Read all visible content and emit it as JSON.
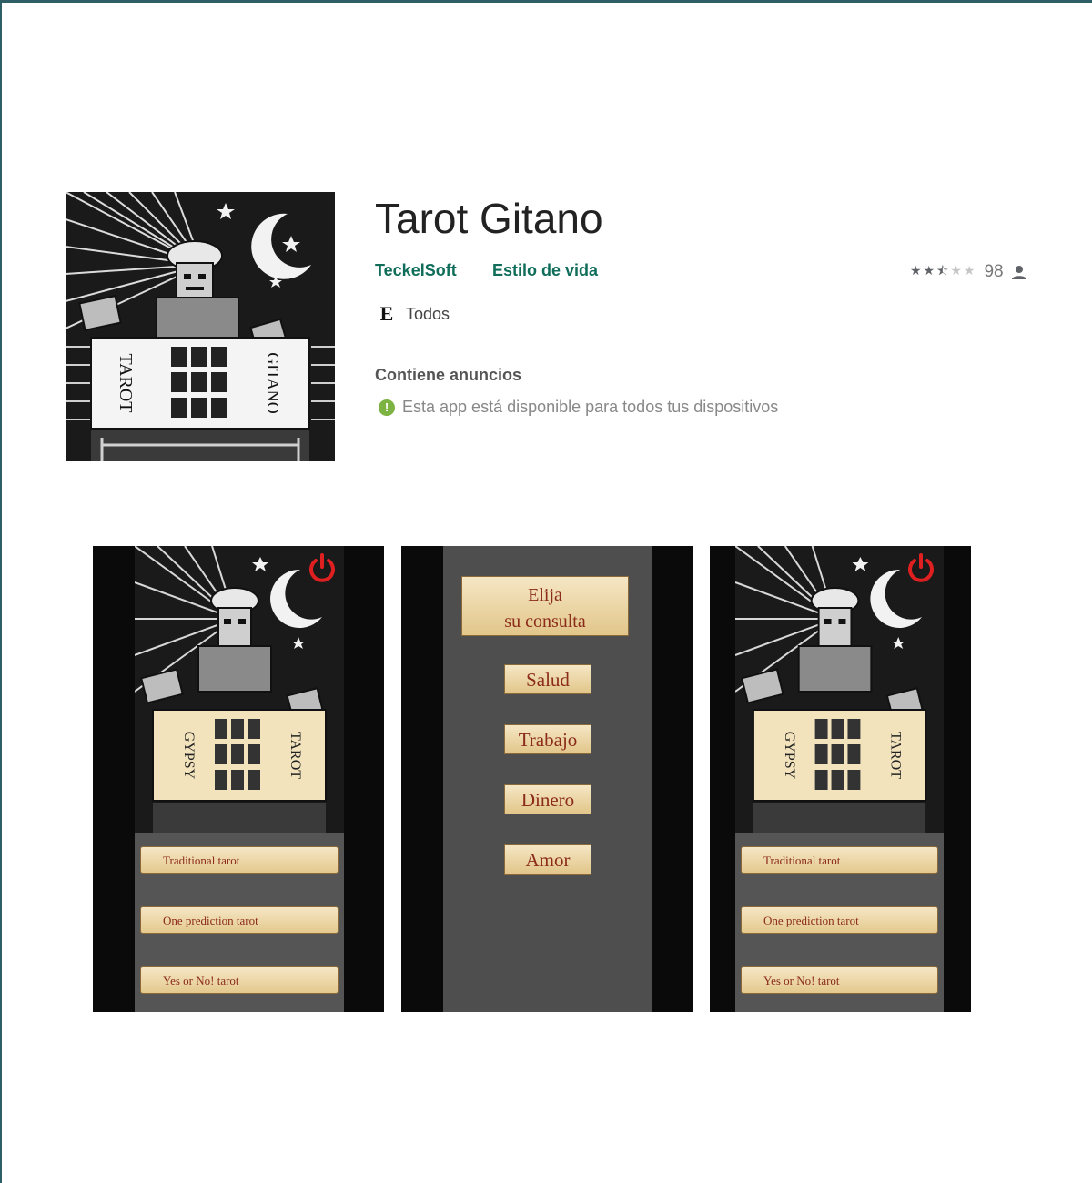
{
  "app": {
    "title": "Tarot Gitano",
    "developer": "TeckelSoft",
    "category": "Estilo de vida",
    "rating": {
      "stars": 2.5,
      "count": "98"
    },
    "content_rating": {
      "badge": "E",
      "label": "Todos"
    },
    "ads_notice": "Contiene anuncios",
    "availability": "Esta app está disponible para todos tus dispositivos",
    "icon_lettering": {
      "left": "TAROT",
      "right": "GITANO"
    }
  },
  "screenshots": [
    {
      "card_lettering": {
        "left": "GYPSY",
        "right": "TAROT"
      },
      "buttons": [
        "Traditional tarot",
        "One prediction tarot",
        "Yes or No! tarot"
      ]
    },
    {
      "heading": [
        "Elija",
        "su consulta"
      ],
      "buttons": [
        "Salud",
        "Trabajo",
        "Dinero",
        "Amor"
      ]
    },
    {
      "card_lettering": {
        "left": "GYPSY",
        "right": "TAROT"
      },
      "buttons": [
        "Traditional tarot",
        "One prediction tarot",
        "Yes or No! tarot"
      ]
    }
  ],
  "colors": {
    "brand_green": "#0f6d5a",
    "power_red": "#e02020",
    "parchment": "#f2e3bd"
  },
  "icons": [
    "user-icon",
    "info-icon",
    "power-icon",
    "star-icon",
    "moon-icon"
  ]
}
